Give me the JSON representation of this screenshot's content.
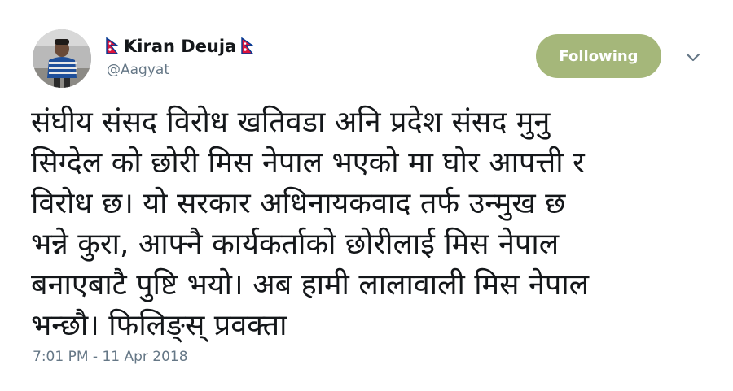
{
  "tweet": {
    "author": {
      "display_name": "Kiran Deuja",
      "handle": "@Aagyat",
      "avatar_icon": "profile-photo",
      "flag_icon": "nepal-flag-icon"
    },
    "follow_button_label": "Following",
    "menu_icon": "chevron-down-icon",
    "text": "संघीय संसद विरोध खतिवडा अनि प्रदेश संसद मुनु\nसिग्देल को छोरी मिस नेपाल भएको मा घोर आपत्ती र\nविरोध छ। यो सरकार अधिनायकवाद तर्फ उन्मुख छ\nभन्ने कुरा, आफ्नै कार्यकर्ताको छोरीलाई मिस नेपाल\nबनाएबाटै पुष्टि भयो। अब हामी लालावाली मिस नेपाल\nभन्छौ। फिलिङ्स् प्रवक्ता",
    "timestamp": "7:01 PM - 11 Apr 2018"
  },
  "colors": {
    "follow_button_bg": "#a5b77a",
    "secondary_text": "#657786",
    "primary_text": "#14171a",
    "flag_red": "#dc143c",
    "flag_blue": "#003893"
  }
}
